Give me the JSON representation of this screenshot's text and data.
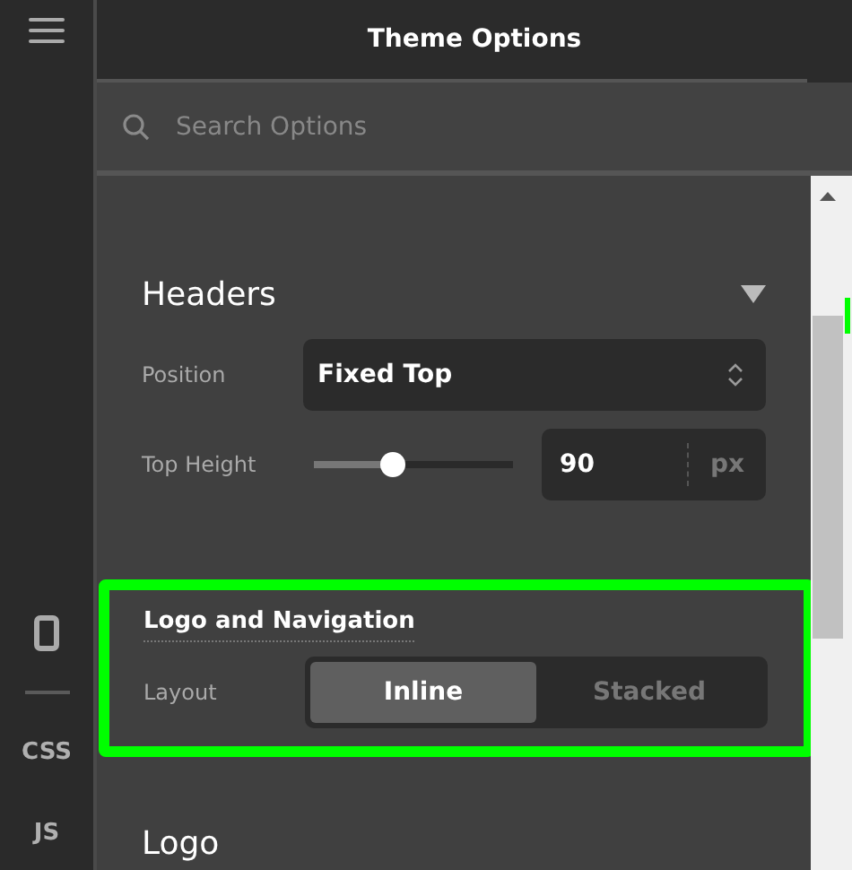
{
  "rail": {
    "items": [
      {
        "kind": "menu"
      },
      {
        "kind": "device"
      },
      {
        "kind": "divider"
      },
      {
        "kind": "text",
        "label": "CSS"
      },
      {
        "kind": "text",
        "label": "JS"
      }
    ]
  },
  "panel": {
    "title": "Theme Options"
  },
  "search": {
    "placeholder": "Search Options"
  },
  "sections": [
    {
      "title": "Headers",
      "kind": "group",
      "expanded": true,
      "rows": [
        {
          "kind": "select",
          "label": "Position",
          "value": "Fixed Top"
        },
        {
          "kind": "slider",
          "label": "Top Height",
          "level": 0.4,
          "value": "90",
          "unit": "px"
        }
      ]
    },
    {
      "title": "Logo and Navigation",
      "kind": "subgroup",
      "highlighted": true,
      "rows": [
        {
          "kind": "segmented",
          "label": "Layout",
          "options": [
            {
              "label": "Inline",
              "selected": true
            },
            {
              "label": "Stacked",
              "selected": false
            }
          ]
        }
      ]
    },
    {
      "title": "Logo",
      "kind": "group"
    }
  ]
}
